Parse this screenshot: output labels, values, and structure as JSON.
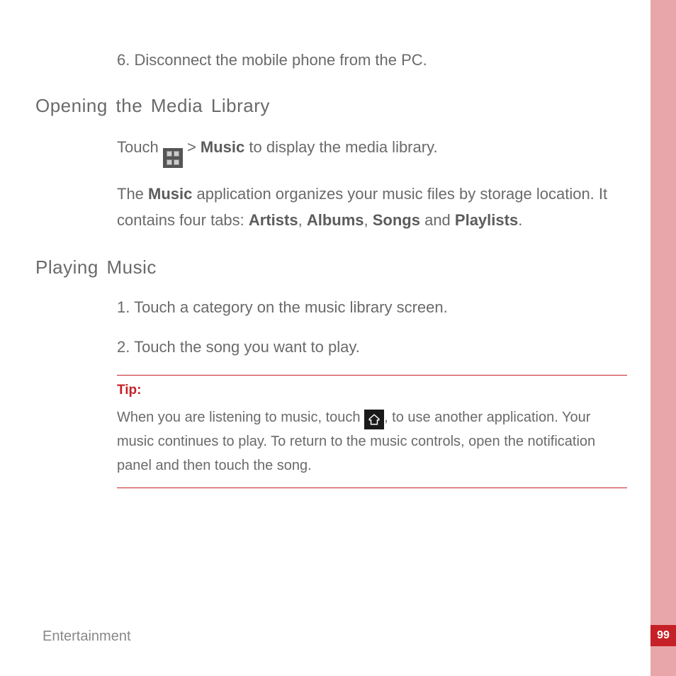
{
  "step6": "6. Disconnect the mobile phone from the PC.",
  "heading_open": "Opening the Media Library",
  "open_touch_pre": "Touch ",
  "open_touch_mid": " > ",
  "open_touch_music": "Music",
  "open_touch_post": " to display the media library.",
  "open_para_pre": "The ",
  "open_para_music": "Music",
  "open_para_mid": " application organizes your music files by storage location. It contains four tabs: ",
  "open_para_artists": "Artists",
  "open_para_c1": ", ",
  "open_para_albums": "Albums",
  "open_para_c2": ", ",
  "open_para_songs": "Songs",
  "open_para_and": " and ",
  "open_para_playlists": "Playlists",
  "open_para_dot": ".",
  "heading_play": "Playing Music",
  "play_step1": "1. Touch a category on the music library screen.",
  "play_step2": "2. Touch the song you want to play.",
  "tip_label": "Tip:",
  "tip_pre": "When you are listening to music, touch ",
  "tip_post": ", to use another application. Your music continues to play. To return to the music controls, open the notification panel and then touch the song.",
  "section": "Entertainment",
  "page_number": "99"
}
